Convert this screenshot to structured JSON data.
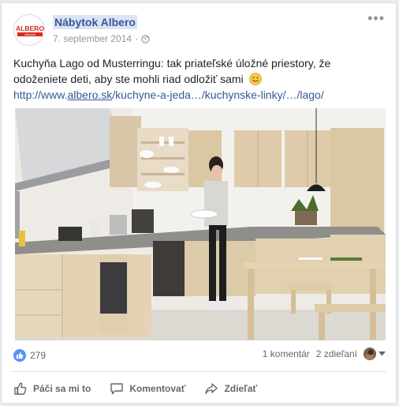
{
  "post": {
    "page_name": "Nábytok Albero",
    "date": "7. september 2014",
    "logo_text": "ALBERO",
    "logo_sub": "nábytok",
    "text_line1": "Kuchyňa Lago od Musterringu: tak priateľské úložné priestory, že",
    "text_line2": "odoženiete deti, aby ste mohli riad odložiť sami",
    "link_prefix": "http://www.",
    "link_domain": "albero.sk",
    "link_rest": "/kuchyne-a-jeda…/kuchynske-linky/…/lago/"
  },
  "stats": {
    "likes": "279",
    "comments": "1 komentár",
    "shares": "2 zdieľaní"
  },
  "actions": {
    "like": "Páči sa mi to",
    "comment": "Komentovať",
    "share": "Zdieľať"
  },
  "colors": {
    "link": "#365899",
    "like_blue": "#5890ff",
    "logo_red": "#d9281e"
  }
}
